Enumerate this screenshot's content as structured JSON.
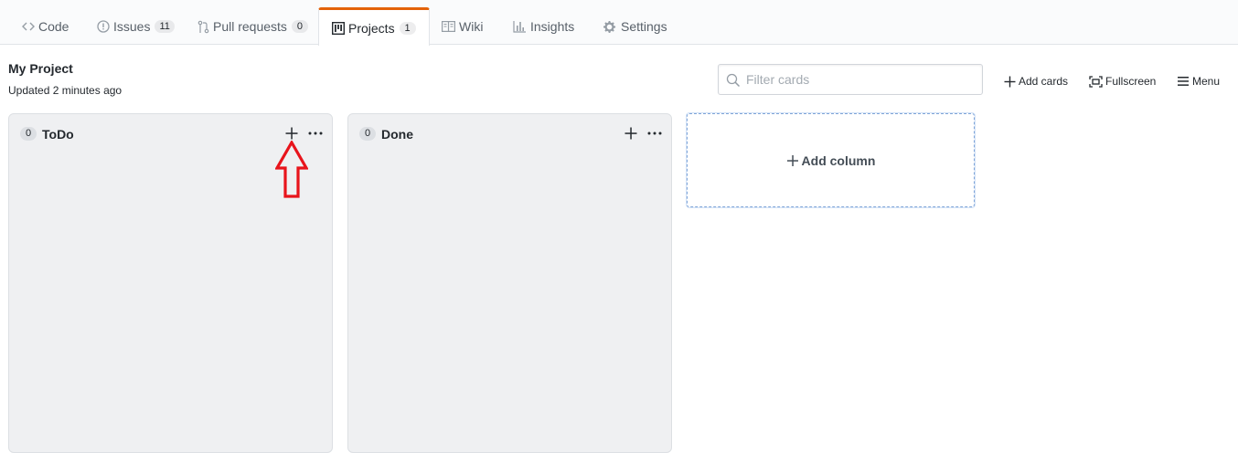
{
  "tabs": [
    {
      "label": "Code",
      "icon": "code-icon",
      "counter": null,
      "selected": false
    },
    {
      "label": "Issues",
      "icon": "issue-opened-icon",
      "counter": "11",
      "selected": false
    },
    {
      "label": "Pull requests",
      "icon": "git-pull-request-icon",
      "counter": "0",
      "selected": false
    },
    {
      "label": "Projects",
      "icon": "project-icon",
      "counter": "1",
      "selected": true
    },
    {
      "label": "Wiki",
      "icon": "book-icon",
      "counter": null,
      "selected": false
    },
    {
      "label": "Insights",
      "icon": "graph-icon",
      "counter": null,
      "selected": false
    },
    {
      "label": "Settings",
      "icon": "gear-icon",
      "counter": null,
      "selected": false
    }
  ],
  "project": {
    "title": "My Project",
    "updated": "Updated 2 minutes ago"
  },
  "filter": {
    "placeholder": "Filter cards",
    "value": ""
  },
  "header_actions": {
    "add_cards": "Add cards",
    "fullscreen": "Fullscreen",
    "menu": "Menu"
  },
  "columns": [
    {
      "name": "ToDo",
      "count": "0"
    },
    {
      "name": "Done",
      "count": "0"
    }
  ],
  "add_column": {
    "label": "Add column"
  },
  "colors": {
    "selected_tab_accent": "#e36209",
    "annotation_arrow": "#e8141c",
    "column_bg": "#eff0f2",
    "add_column_border": "#80a5d8"
  }
}
